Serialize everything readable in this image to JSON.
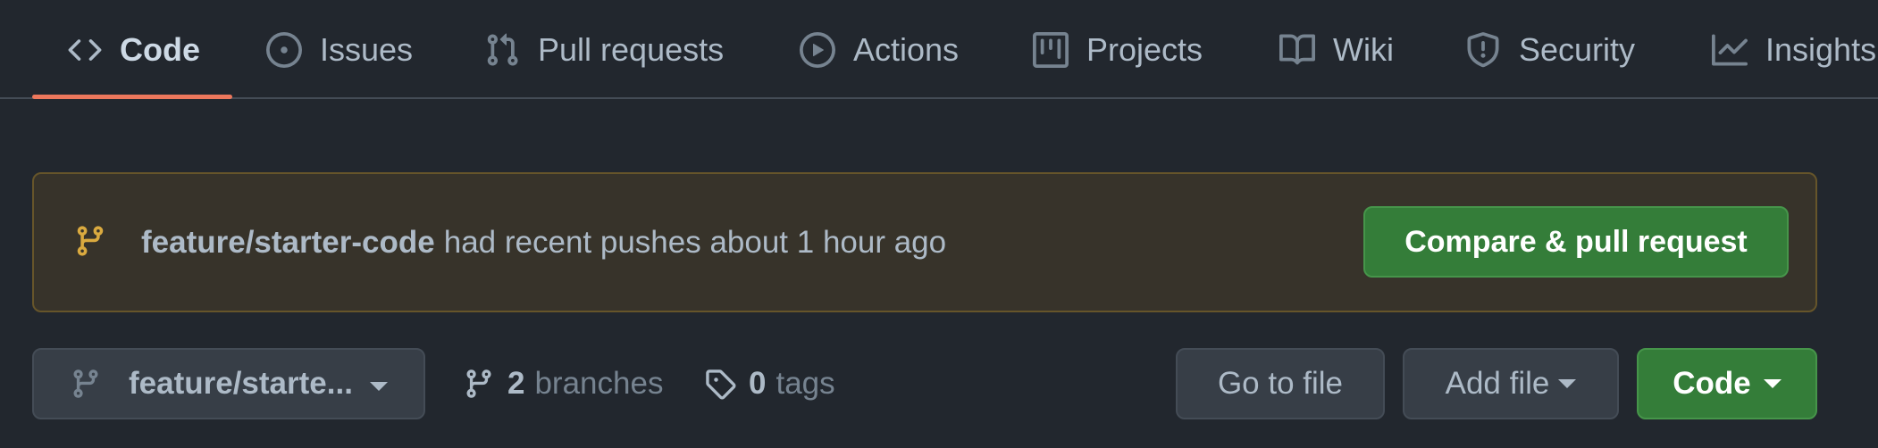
{
  "tabs": [
    {
      "label": "Code",
      "icon": "code-icon",
      "selected": true
    },
    {
      "label": "Issues",
      "icon": "issue-opened-icon"
    },
    {
      "label": "Pull requests",
      "icon": "git-pull-request-icon"
    },
    {
      "label": "Actions",
      "icon": "play-icon"
    },
    {
      "label": "Projects",
      "icon": "table-icon"
    },
    {
      "label": "Wiki",
      "icon": "book-icon"
    },
    {
      "label": "Security",
      "icon": "shield-icon"
    },
    {
      "label": "Insights",
      "icon": "graph-icon"
    }
  ],
  "banner": {
    "branch": "feature/starter-code",
    "message": "had recent pushes about 1 hour ago",
    "button_label": "Compare & pull request",
    "icon": "git-branch-icon"
  },
  "toolbar": {
    "branch_select_label": "feature/starte...",
    "branches_count": "2",
    "branches_label": "branches",
    "tags_count": "0",
    "tags_label": "tags",
    "go_to_file_label": "Go to file",
    "add_file_label": "Add file",
    "code_label": "Code"
  },
  "colors": {
    "background": "#22272e",
    "accent_underline": "#ec775c",
    "primary_button": "#347d39",
    "banner_bg": "#37332a",
    "banner_icon": "#daaa3f"
  }
}
